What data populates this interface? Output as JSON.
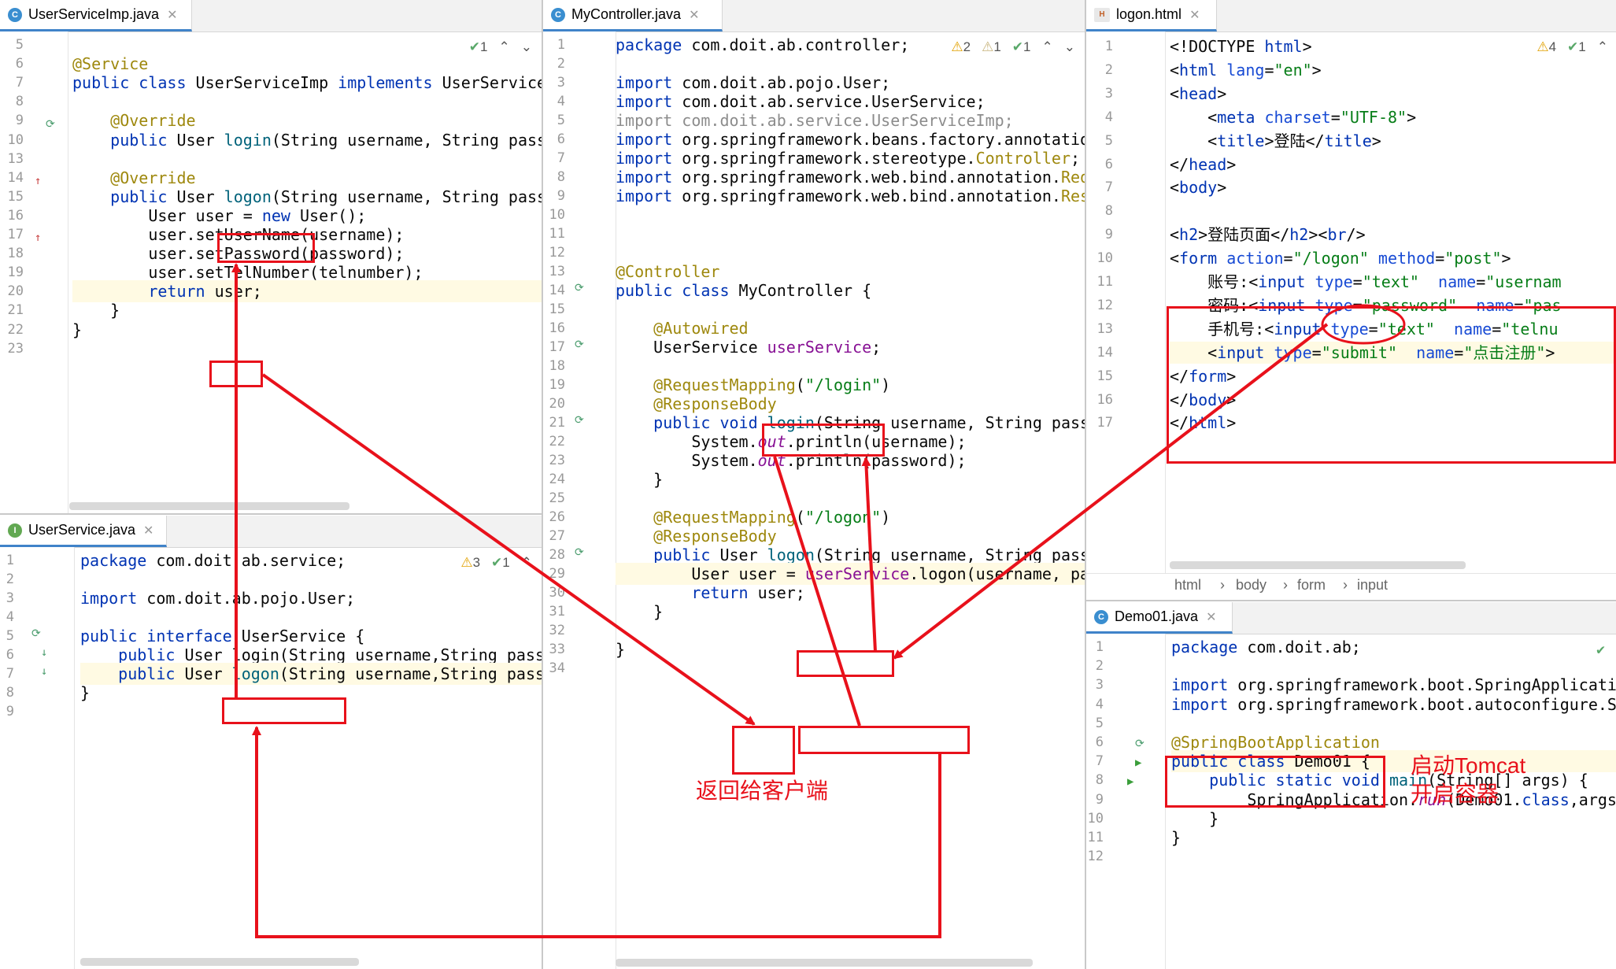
{
  "tabs": {
    "impl": "UserServiceImp.java",
    "controller": "MyController.java",
    "logon": "logon.html",
    "service": "UserService.java",
    "demo": "Demo01.java"
  },
  "indicators": {
    "impl": "1",
    "controller_w1": "2",
    "controller_w2": "1",
    "controller_ok": "1",
    "logon_w": "4",
    "logon_ok": "1",
    "service_w": "3",
    "service_ok": "1"
  },
  "breadcrumb": [
    "html",
    "body",
    "form",
    "input"
  ],
  "annotations": {
    "return_to_client": "返回给客户端",
    "start_tomcat_1": "启动Tomcat",
    "start_tomcat_2": "开启容器"
  },
  "impl_lines": [
    {
      "n": "5",
      "c": [
        [
          "",
          ""
        ]
      ]
    },
    {
      "n": "6",
      "c": [
        [
          "ann",
          "@Service"
        ]
      ]
    },
    {
      "n": "7",
      "c": [
        [
          "kw",
          "public class "
        ],
        [
          "",
          "UserServiceImp "
        ],
        [
          "kw",
          "implements "
        ],
        [
          "",
          "UserService"
        ]
      ]
    },
    {
      "n": "8",
      "c": [
        [
          "",
          ""
        ]
      ]
    },
    {
      "n": "9",
      "c": [
        [
          "ann",
          "    @Override"
        ]
      ]
    },
    {
      "n": "10",
      "c": [
        [
          "kw",
          "    public "
        ],
        [
          "",
          "User "
        ],
        [
          "fn",
          "login"
        ],
        [
          "",
          "(String username, String pass"
        ]
      ]
    },
    {
      "n": "13",
      "c": [
        [
          "",
          ""
        ]
      ]
    },
    {
      "n": "14",
      "c": [
        [
          "ann",
          "    @Override"
        ]
      ]
    },
    {
      "n": "15",
      "c": [
        [
          "kw",
          "    public "
        ],
        [
          "",
          "User "
        ],
        [
          "fn",
          "logon"
        ],
        [
          "",
          "(String username, String pass"
        ]
      ]
    },
    {
      "n": "16",
      "c": [
        [
          "",
          "        User user = "
        ],
        [
          "kw",
          "new "
        ],
        [
          "",
          "User();"
        ]
      ]
    },
    {
      "n": "17",
      "c": [
        [
          "",
          "        user.setUserName(username);"
        ]
      ]
    },
    {
      "n": "18",
      "c": [
        [
          "",
          "        user.setPassword(password);"
        ]
      ]
    },
    {
      "n": "19",
      "c": [
        [
          "",
          "        user.setTelNumber(telnumber);"
        ]
      ]
    },
    {
      "n": "20",
      "c": [
        [
          "kw",
          "        return "
        ],
        [
          "",
          "user;"
        ]
      ]
    },
    {
      "n": "21",
      "c": [
        [
          "",
          "    }"
        ]
      ]
    },
    {
      "n": "22",
      "c": [
        [
          "",
          "}"
        ]
      ]
    },
    {
      "n": "23",
      "c": [
        [
          "",
          ""
        ]
      ]
    }
  ],
  "service_lines": [
    {
      "n": "1",
      "c": [
        [
          "kw",
          "package "
        ],
        [
          "",
          "com.doit.ab.service;"
        ]
      ]
    },
    {
      "n": "2",
      "c": [
        [
          "",
          ""
        ]
      ]
    },
    {
      "n": "3",
      "c": [
        [
          "kw",
          "import "
        ],
        [
          "",
          "com.doit.ab.pojo.User;"
        ]
      ]
    },
    {
      "n": "4",
      "c": [
        [
          "",
          ""
        ]
      ]
    },
    {
      "n": "5",
      "c": [
        [
          "kw",
          "public interface "
        ],
        [
          "",
          "UserService {"
        ]
      ]
    },
    {
      "n": "6",
      "c": [
        [
          "kw",
          "    public "
        ],
        [
          "",
          "User login(String username,String pass"
        ]
      ]
    },
    {
      "n": "7",
      "c": [
        [
          "kw",
          "    public "
        ],
        [
          "",
          "User "
        ],
        [
          "fn",
          "logon"
        ],
        [
          "",
          "(String username,String pass"
        ]
      ]
    },
    {
      "n": "8",
      "c": [
        [
          "",
          "}"
        ]
      ]
    },
    {
      "n": "9",
      "c": [
        [
          "",
          ""
        ]
      ]
    }
  ],
  "controller_lines": [
    {
      "n": "1",
      "c": [
        [
          "kw",
          "package "
        ],
        [
          "",
          "com.doit.ab.controller;"
        ]
      ]
    },
    {
      "n": "2",
      "c": [
        [
          "",
          ""
        ]
      ]
    },
    {
      "n": "3",
      "c": [
        [
          "kw",
          "import "
        ],
        [
          "",
          "com.doit.ab.pojo.User;"
        ]
      ]
    },
    {
      "n": "4",
      "c": [
        [
          "kw",
          "import "
        ],
        [
          "",
          "com.doit.ab.service.UserService;"
        ]
      ]
    },
    {
      "n": "5",
      "c": [
        [
          "cmt",
          "import com.doit.ab.service.UserServiceImp;"
        ]
      ]
    },
    {
      "n": "6",
      "c": [
        [
          "kw",
          "import "
        ],
        [
          "",
          "org.springframework.beans.factory.annotatio"
        ]
      ]
    },
    {
      "n": "7",
      "c": [
        [
          "kw",
          "import "
        ],
        [
          "",
          "org.springframework.stereotype."
        ],
        [
          "ann",
          "Controller"
        ],
        [
          "",
          ";"
        ]
      ]
    },
    {
      "n": "8",
      "c": [
        [
          "kw",
          "import "
        ],
        [
          "",
          "org.springframework.web.bind.annotation."
        ],
        [
          "ann",
          "Req"
        ]
      ]
    },
    {
      "n": "9",
      "c": [
        [
          "kw",
          "import "
        ],
        [
          "",
          "org.springframework.web.bind.annotation."
        ],
        [
          "ann",
          "Res"
        ]
      ]
    },
    {
      "n": "10",
      "c": [
        [
          "",
          ""
        ]
      ]
    },
    {
      "n": "11",
      "c": [
        [
          "",
          ""
        ]
      ]
    },
    {
      "n": "12",
      "c": [
        [
          "",
          ""
        ]
      ]
    },
    {
      "n": "13",
      "c": [
        [
          "ann",
          "@Controller"
        ]
      ]
    },
    {
      "n": "14",
      "c": [
        [
          "kw",
          "public class "
        ],
        [
          "",
          "MyController {"
        ]
      ]
    },
    {
      "n": "15",
      "c": [
        [
          "",
          ""
        ]
      ]
    },
    {
      "n": "16",
      "c": [
        [
          "ann",
          "    @Autowired"
        ]
      ]
    },
    {
      "n": "17",
      "c": [
        [
          "",
          "    UserService "
        ],
        [
          "fld",
          "userService"
        ],
        [
          "",
          ";"
        ]
      ]
    },
    {
      "n": "18",
      "c": [
        [
          "",
          ""
        ]
      ]
    },
    {
      "n": "19",
      "c": [
        [
          "ann",
          "    @RequestMapping"
        ],
        [
          "",
          "("
        ],
        [
          "str",
          "\"/login\""
        ],
        [
          "",
          ")"
        ]
      ]
    },
    {
      "n": "20",
      "c": [
        [
          "ann",
          "    @ResponseBody"
        ]
      ]
    },
    {
      "n": "21",
      "c": [
        [
          "kw",
          "    public void "
        ],
        [
          "fn",
          "login"
        ],
        [
          "",
          "(String username, String pass"
        ]
      ]
    },
    {
      "n": "22",
      "c": [
        [
          "",
          "        System."
        ],
        [
          "st",
          "out"
        ],
        [
          "",
          ".println(username);"
        ]
      ]
    },
    {
      "n": "23",
      "c": [
        [
          "",
          "        System."
        ],
        [
          "st",
          "out"
        ],
        [
          "",
          ".println(password);"
        ]
      ]
    },
    {
      "n": "24",
      "c": [
        [
          "",
          "    }"
        ]
      ]
    },
    {
      "n": "25",
      "c": [
        [
          "",
          ""
        ]
      ]
    },
    {
      "n": "26",
      "c": [
        [
          "ann",
          "    @RequestMapping"
        ],
        [
          "",
          "("
        ],
        [
          "str",
          "\"/logon\""
        ],
        [
          "",
          ")"
        ]
      ]
    },
    {
      "n": "27",
      "c": [
        [
          "ann",
          "    @ResponseBody"
        ]
      ]
    },
    {
      "n": "28",
      "c": [
        [
          "kw",
          "    public "
        ],
        [
          "",
          "User "
        ],
        [
          "fn",
          "logon"
        ],
        [
          "",
          "(String username, String pass"
        ]
      ]
    },
    {
      "n": "29",
      "c": [
        [
          "",
          "        User user = "
        ],
        [
          "fld",
          "userService"
        ],
        [
          "",
          ".logon(username, pa"
        ]
      ]
    },
    {
      "n": "30",
      "c": [
        [
          "kw",
          "        return "
        ],
        [
          "",
          "user;"
        ]
      ]
    },
    {
      "n": "31",
      "c": [
        [
          "",
          "    }"
        ]
      ]
    },
    {
      "n": "32",
      "c": [
        [
          "",
          ""
        ]
      ]
    },
    {
      "n": "33",
      "c": [
        [
          "",
          "}"
        ]
      ]
    },
    {
      "n": "34",
      "c": [
        [
          "",
          ""
        ]
      ]
    }
  ],
  "logon_lines": [
    {
      "n": "1",
      "c": [
        [
          "",
          "<!DOCTYPE "
        ],
        [
          "tag",
          "html"
        ],
        [
          "",
          ">"
        ]
      ]
    },
    {
      "n": "2",
      "c": [
        [
          "",
          "<"
        ],
        [
          "tag",
          "html "
        ],
        [
          "attr",
          "lang"
        ],
        [
          "",
          "="
        ],
        [
          "str",
          "\"en\""
        ],
        [
          "",
          ">"
        ]
      ]
    },
    {
      "n": "3",
      "c": [
        [
          "",
          "<"
        ],
        [
          "tag",
          "head"
        ],
        [
          "",
          ">"
        ]
      ]
    },
    {
      "n": "4",
      "c": [
        [
          "",
          "    <"
        ],
        [
          "tag",
          "meta "
        ],
        [
          "attr",
          "charset"
        ],
        [
          "",
          "="
        ],
        [
          "str",
          "\"UTF-8\""
        ],
        [
          "",
          ">"
        ]
      ]
    },
    {
      "n": "5",
      "c": [
        [
          "",
          "    <"
        ],
        [
          "tag",
          "title"
        ],
        [
          "",
          ">登陆</"
        ],
        [
          "tag",
          "title"
        ],
        [
          "",
          ">"
        ]
      ]
    },
    {
      "n": "6",
      "c": [
        [
          "",
          "</"
        ],
        [
          "tag",
          "head"
        ],
        [
          "",
          ">"
        ]
      ]
    },
    {
      "n": "7",
      "c": [
        [
          "",
          "<"
        ],
        [
          "tag",
          "body"
        ],
        [
          "",
          ">"
        ]
      ]
    },
    {
      "n": "8",
      "c": [
        [
          "",
          ""
        ]
      ]
    },
    {
      "n": "9",
      "c": [
        [
          "",
          "<"
        ],
        [
          "tag",
          "h2"
        ],
        [
          "",
          ">登陆页面</"
        ],
        [
          "tag",
          "h2"
        ],
        [
          "",
          "><"
        ],
        [
          "tag",
          "br"
        ],
        [
          "",
          "/>"
        ]
      ]
    },
    {
      "n": "10",
      "c": [
        [
          "",
          "<"
        ],
        [
          "tag",
          "form "
        ],
        [
          "attr",
          "action"
        ],
        [
          "",
          "="
        ],
        [
          "str",
          "\"/logon\""
        ],
        [
          "",
          ""
        ],
        [
          "attr",
          " method"
        ],
        [
          "",
          "="
        ],
        [
          "str",
          "\"post\""
        ],
        [
          "",
          ">"
        ]
      ]
    },
    {
      "n": "11",
      "c": [
        [
          "",
          "    账号:<"
        ],
        [
          "tag",
          "input "
        ],
        [
          "attr",
          "type"
        ],
        [
          "",
          "="
        ],
        [
          "str",
          "\"text\""
        ],
        [
          "attr",
          "  name"
        ],
        [
          "",
          "="
        ],
        [
          "str",
          "\"usernam"
        ]
      ]
    },
    {
      "n": "12",
      "c": [
        [
          "",
          "    密码:<"
        ],
        [
          "tag",
          "input "
        ],
        [
          "attr",
          "type"
        ],
        [
          "",
          "="
        ],
        [
          "str",
          "\"password\""
        ],
        [
          "attr",
          "  name"
        ],
        [
          "",
          "="
        ],
        [
          "str",
          "\"pas"
        ]
      ]
    },
    {
      "n": "13",
      "c": [
        [
          "",
          "    手机号:<"
        ],
        [
          "tag",
          "input "
        ],
        [
          "attr",
          "type"
        ],
        [
          "",
          "="
        ],
        [
          "str",
          "\"text\""
        ],
        [
          "attr",
          "  name"
        ],
        [
          "",
          "="
        ],
        [
          "str",
          "\"telnu"
        ]
      ]
    },
    {
      "n": "14",
      "c": [
        [
          "",
          "    <"
        ],
        [
          "tag",
          "input "
        ],
        [
          "attr",
          "type"
        ],
        [
          "",
          "="
        ],
        [
          "str",
          "\"submit\""
        ],
        [
          "attr",
          "  name"
        ],
        [
          "",
          "="
        ],
        [
          "str",
          "\"点击注册\""
        ],
        [
          "",
          ">"
        ]
      ]
    },
    {
      "n": "15",
      "c": [
        [
          "",
          "</"
        ],
        [
          "tag",
          "form"
        ],
        [
          "",
          ">"
        ]
      ]
    },
    {
      "n": "16",
      "c": [
        [
          "",
          "</"
        ],
        [
          "tag",
          "body"
        ],
        [
          "",
          ">"
        ]
      ]
    },
    {
      "n": "17",
      "c": [
        [
          "",
          "</"
        ],
        [
          "tag",
          "html"
        ],
        [
          "",
          ">"
        ]
      ]
    }
  ],
  "demo_lines": [
    {
      "n": "1",
      "c": [
        [
          "kw",
          "package "
        ],
        [
          "",
          "com.doit.ab;"
        ]
      ]
    },
    {
      "n": "2",
      "c": [
        [
          "",
          ""
        ]
      ]
    },
    {
      "n": "3",
      "c": [
        [
          "kw",
          "import "
        ],
        [
          "",
          "org.springframework.boot.SpringApplicati"
        ]
      ]
    },
    {
      "n": "4",
      "c": [
        [
          "kw",
          "import "
        ],
        [
          "",
          "org.springframework.boot.autoconfigure.S"
        ]
      ]
    },
    {
      "n": "5",
      "c": [
        [
          "",
          ""
        ]
      ]
    },
    {
      "n": "6",
      "c": [
        [
          "ann",
          "@SpringBootApplication"
        ]
      ]
    },
    {
      "n": "7",
      "c": [
        [
          "kw",
          "public class "
        ],
        [
          "",
          "Demo01 {"
        ]
      ]
    },
    {
      "n": "8",
      "c": [
        [
          "kw",
          "    public static void "
        ],
        [
          "fn",
          "main"
        ],
        [
          "",
          "(String[] args) {"
        ]
      ]
    },
    {
      "n": "9",
      "c": [
        [
          "",
          "        SpringApplication."
        ],
        [
          "st",
          "run"
        ],
        [
          "",
          "(Demo01."
        ],
        [
          "kw",
          "class"
        ],
        [
          "",
          ",args"
        ]
      ]
    },
    {
      "n": "10",
      "c": [
        [
          "",
          "    }"
        ]
      ]
    },
    {
      "n": "11",
      "c": [
        [
          "",
          "}"
        ]
      ]
    },
    {
      "n": "12",
      "c": [
        [
          "",
          ""
        ]
      ]
    }
  ]
}
